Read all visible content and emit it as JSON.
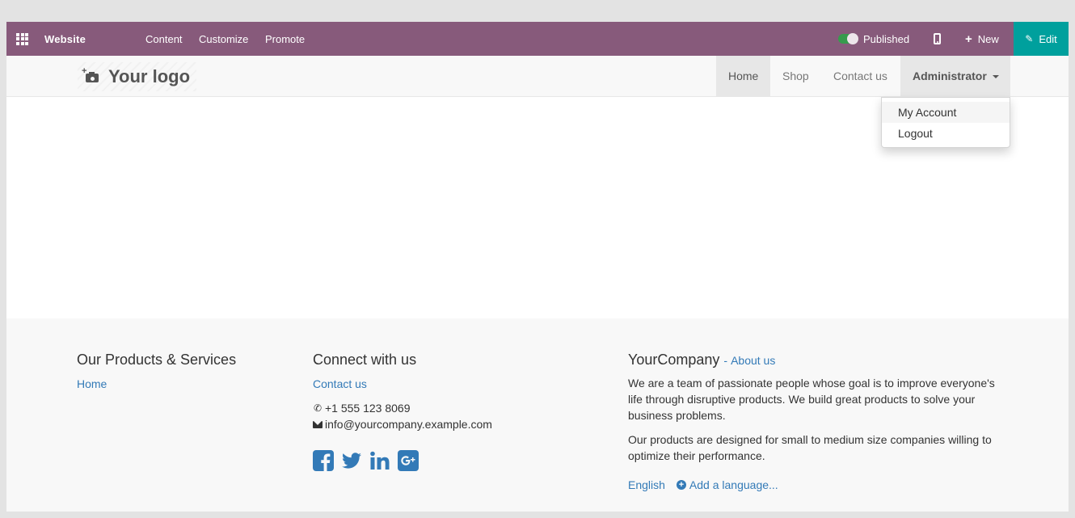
{
  "topbar": {
    "app_title": "Website",
    "menu": [
      "Content",
      "Customize",
      "Promote"
    ],
    "publish_label": "Published",
    "published": true,
    "new_label": "New",
    "edit_label": "Edit",
    "apps_icon": "apps-grid-icon",
    "mobile_icon": "mobile-icon",
    "colors": {
      "bar": "#875a7b",
      "edit": "#00a09d",
      "toggle_on": "#28a745"
    }
  },
  "navbar": {
    "logo_text": "Your logo",
    "logo_icon": "camera-icon",
    "links": [
      "Home",
      "Shop",
      "Contact us"
    ],
    "active_link": "Home",
    "user_menu": "Administrator",
    "dropdown": [
      "My Account",
      "Logout"
    ]
  },
  "footer": {
    "products": {
      "heading": "Our Products & Services",
      "links": [
        "Home"
      ]
    },
    "connect": {
      "heading": "Connect with us",
      "contact_link": "Contact us",
      "phone": "+1 555 123 8069",
      "email": "info@yourcompany.example.com",
      "social": [
        "facebook-icon",
        "twitter-icon",
        "linkedin-icon",
        "google-plus-icon"
      ]
    },
    "company": {
      "name": "YourCompany",
      "about_sep": "-",
      "about_link": "About us",
      "paragraph1": "We are a team of passionate people whose goal is to improve everyone's life through disruptive products. We build great products to solve your business problems.",
      "paragraph2": "Our products are designed for small to medium size companies willing to optimize their performance.",
      "language": "English",
      "add_language": "Add a language..."
    },
    "link_color": "#337ab7"
  }
}
